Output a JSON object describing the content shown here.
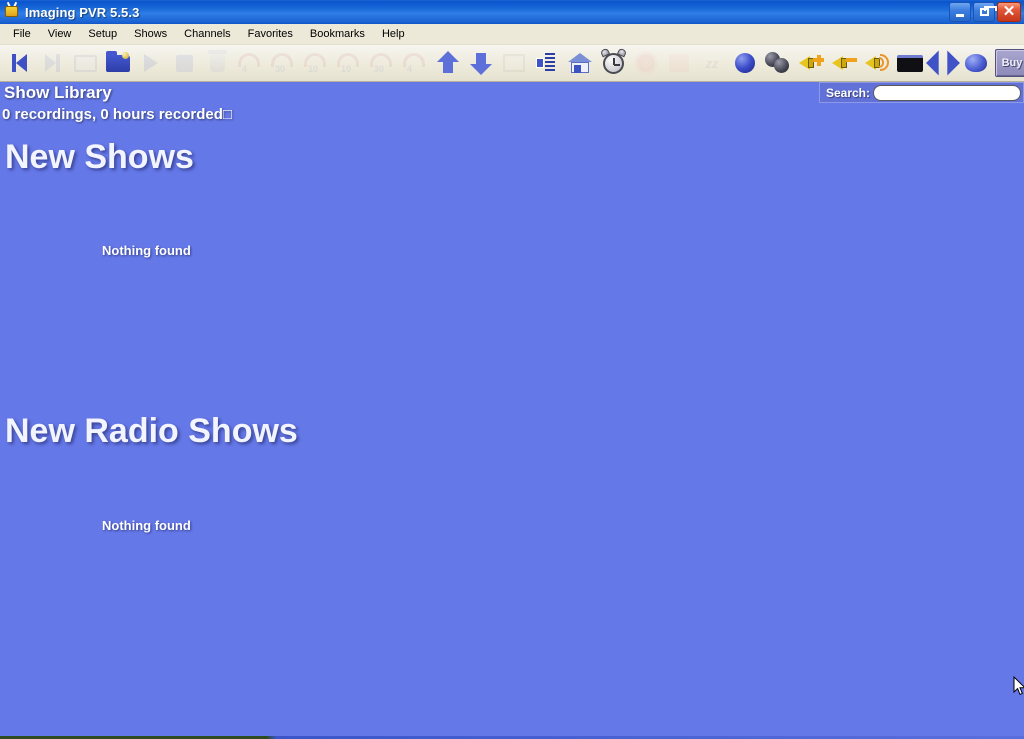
{
  "window": {
    "title": "Imaging PVR 5.5.3",
    "app_icon": "tv-antenna-icon",
    "controls": {
      "minimize": "_",
      "maximize": "restore",
      "close": "✕"
    }
  },
  "menubar": {
    "items": [
      {
        "label": "File"
      },
      {
        "label": "View"
      },
      {
        "label": "Setup"
      },
      {
        "label": "Shows"
      },
      {
        "label": "Channels"
      },
      {
        "label": "Favorites"
      },
      {
        "label": "Bookmarks"
      },
      {
        "label": "Help"
      }
    ]
  },
  "toolbar": {
    "buttons": [
      {
        "name": "back-icon",
        "enabled": true
      },
      {
        "name": "forward-icon",
        "enabled": false
      },
      {
        "name": "monitor-icon",
        "enabled": false
      },
      {
        "name": "folder-icon",
        "enabled": true
      },
      {
        "name": "play-icon",
        "enabled": false
      },
      {
        "name": "stop-icon",
        "enabled": false
      },
      {
        "name": "trash-icon",
        "enabled": false
      },
      {
        "name": "replay-4s-icon",
        "enabled": false
      },
      {
        "name": "replay-30s-icon",
        "enabled": false
      },
      {
        "name": "replay-10s-icon",
        "enabled": false
      },
      {
        "name": "replay-10s-alt-icon",
        "enabled": false
      },
      {
        "name": "replay-30s-alt-icon",
        "enabled": false
      },
      {
        "name": "replay-4s-alt-icon",
        "enabled": false
      },
      {
        "name": "upload-icon",
        "enabled": true
      },
      {
        "name": "download-icon",
        "enabled": true
      },
      {
        "name": "calendar-icon",
        "enabled": false
      },
      {
        "name": "guide-icon",
        "enabled": true
      },
      {
        "name": "home-icon",
        "enabled": true
      },
      {
        "name": "alarm-clock-icon",
        "enabled": true
      },
      {
        "name": "brightness-icon",
        "enabled": false
      },
      {
        "name": "contrast-icon",
        "enabled": false
      },
      {
        "name": "sleep-icon",
        "enabled": false
      },
      {
        "name": "sphere-icon",
        "enabled": true
      },
      {
        "name": "dual-sphere-icon",
        "enabled": true
      },
      {
        "name": "volume-up-icon",
        "enabled": true
      },
      {
        "name": "volume-down-icon",
        "enabled": true
      },
      {
        "name": "volume-icon",
        "enabled": true
      },
      {
        "name": "blank-screen-icon",
        "enabled": true
      },
      {
        "name": "fullscreen-icon",
        "enabled": true
      },
      {
        "name": "knob-icon",
        "enabled": true
      }
    ],
    "buy_label": "Buy"
  },
  "search": {
    "label": "Search:",
    "value": "",
    "placeholder": ""
  },
  "library": {
    "title": "Show Library",
    "summary": "0 recordings, 0 hours recorded□"
  },
  "sections": [
    {
      "heading": "New Shows",
      "empty_text": "Nothing found"
    },
    {
      "heading": "New Radio Shows",
      "empty_text": "Nothing found"
    }
  ],
  "colors": {
    "content_background": "#6578e8",
    "titlebar_blue": "#0a55cd",
    "toolbar_background": "#ece9d8",
    "text_white": "#ffffff",
    "buy_button": "#8d89b9"
  }
}
